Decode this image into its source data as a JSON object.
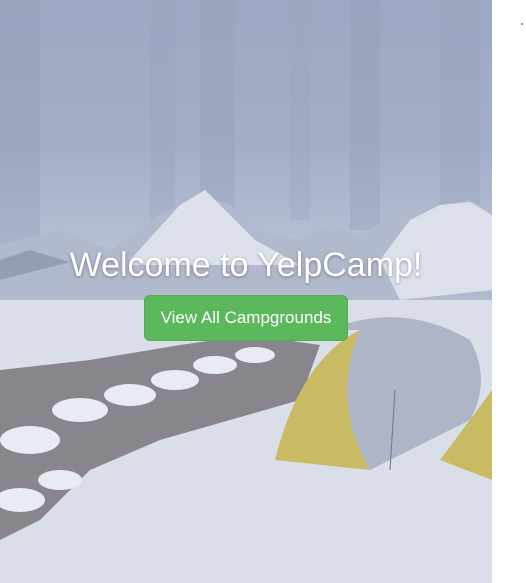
{
  "hero": {
    "title": "Welcome to YelpCamp!",
    "cta_label": "View All Campgrounds"
  },
  "colors": {
    "cta_background": "#5cb85c",
    "title_text": "#ffffff"
  }
}
